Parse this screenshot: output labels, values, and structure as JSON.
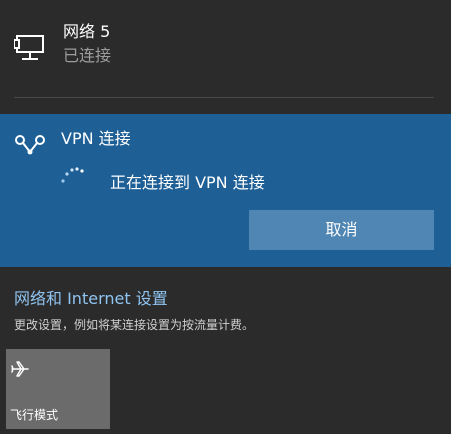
{
  "network": {
    "name": "网络 5",
    "status": "已连接",
    "icon": "ethernet-icon"
  },
  "vpn": {
    "title": "VPN 连接",
    "icon": "vpn-icon",
    "status": "正在连接到 VPN 连接",
    "cancel_label": "取消",
    "panel_color": "#1e5f96",
    "button_color": "#4f86b3"
  },
  "settings": {
    "link_text": "网络和 Internet 设置",
    "description": "更改设置，例如将某连接设置为按流量计费。",
    "link_color": "#8fc4f1"
  },
  "quick_actions": [
    {
      "label": "飞行模式",
      "icon": "airplane-icon"
    }
  ],
  "colors": {
    "background": "#2b2b2b",
    "secondary_text": "#9d9d9d"
  }
}
